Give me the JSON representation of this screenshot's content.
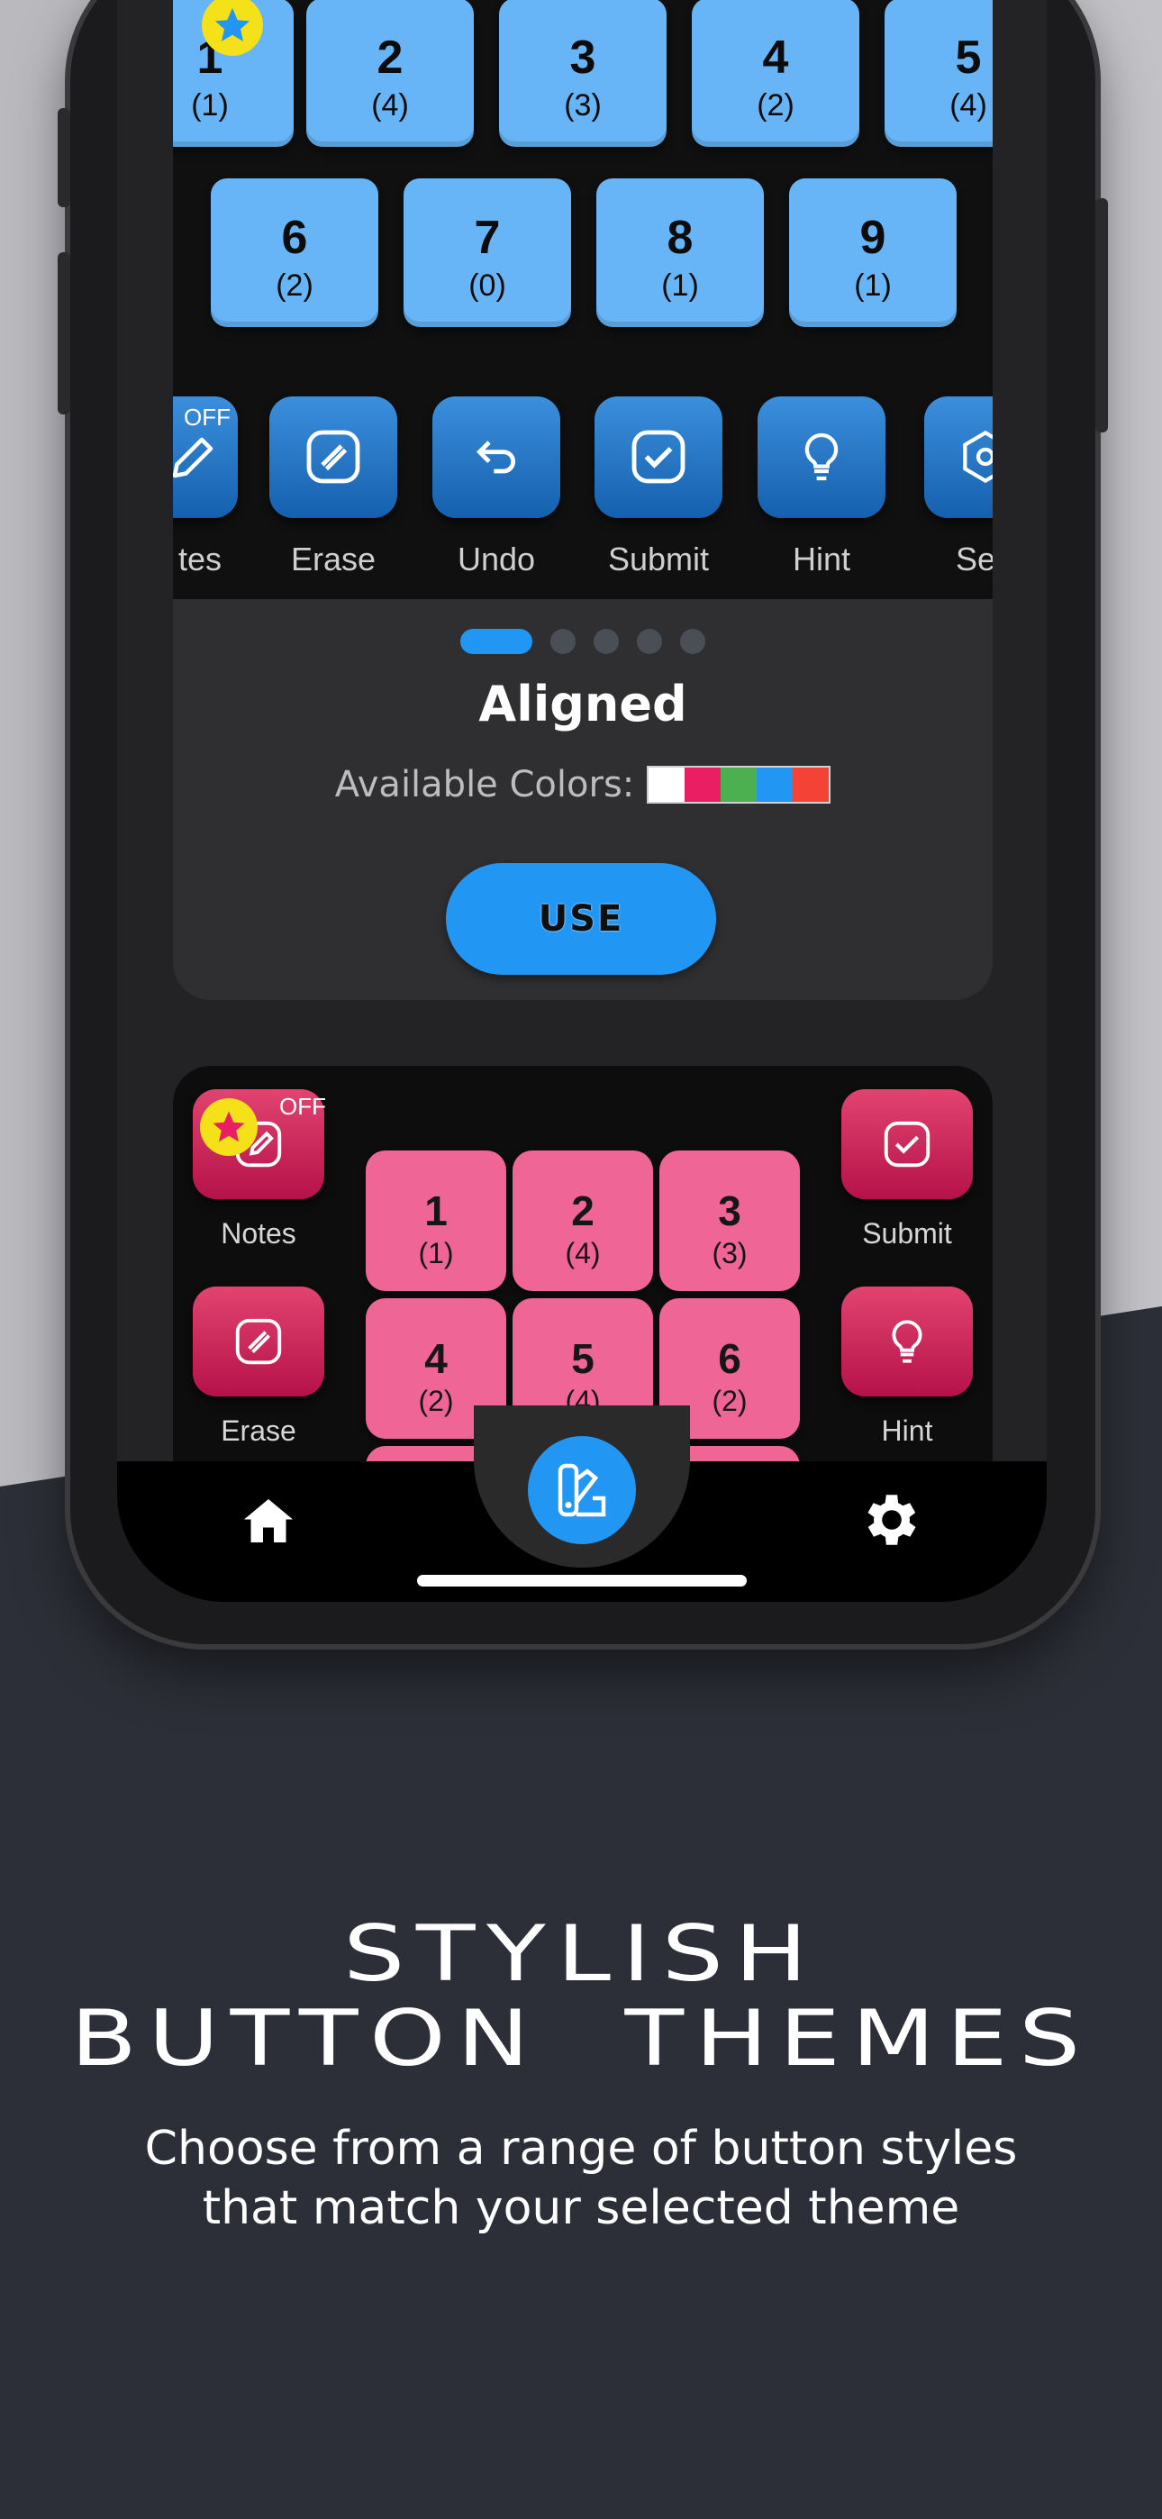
{
  "top_preview": {
    "row1": [
      {
        "num": "1",
        "count": "(1)"
      },
      {
        "num": "2",
        "count": "(4)"
      },
      {
        "num": "3",
        "count": "(3)"
      },
      {
        "num": "4",
        "count": "(2)"
      },
      {
        "num": "5",
        "count": "(4)"
      }
    ],
    "row2": [
      {
        "num": "6",
        "count": "(2)"
      },
      {
        "num": "7",
        "count": "(0)"
      },
      {
        "num": "8",
        "count": "(1)"
      },
      {
        "num": "9",
        "count": "(1)"
      }
    ],
    "tools": [
      "tes",
      "Erase",
      "Undo",
      "Submit",
      "Hint",
      "Setti"
    ],
    "notes_badge": "OFF"
  },
  "theme_card": {
    "title": "Aligned",
    "colors_label": "Available Colors:",
    "swatches": [
      "#ffffff",
      "#e91e63",
      "#4caf50",
      "#2196f3",
      "#f44336"
    ],
    "use_label": "USE",
    "page_count": 5,
    "active_page": 1
  },
  "bottom_preview": {
    "left_tools": [
      "Notes",
      "Erase"
    ],
    "right_tools": [
      "Submit",
      "Hint"
    ],
    "notes_badge": "OFF",
    "keys": [
      {
        "num": "1",
        "count": "(1)"
      },
      {
        "num": "2",
        "count": "(4)"
      },
      {
        "num": "3",
        "count": "(3)"
      },
      {
        "num": "4",
        "count": "(2)"
      },
      {
        "num": "5",
        "count": "(4)"
      },
      {
        "num": "6",
        "count": "(2)"
      }
    ]
  },
  "nav": {
    "left_icon": "home-icon",
    "center_icon": "palette-icon",
    "right_icon": "gear-icon"
  },
  "headline": {
    "line1": "STYLISH",
    "line2": "BUTTON  THEMES"
  },
  "subline": {
    "line1": "Choose from a range of button styles",
    "line2": "that match your selected theme"
  },
  "colors": {
    "accent": "#2196f3",
    "key_blue": "#67b4f6",
    "key_pink": "#ef6595",
    "background": "#2c2f37"
  }
}
